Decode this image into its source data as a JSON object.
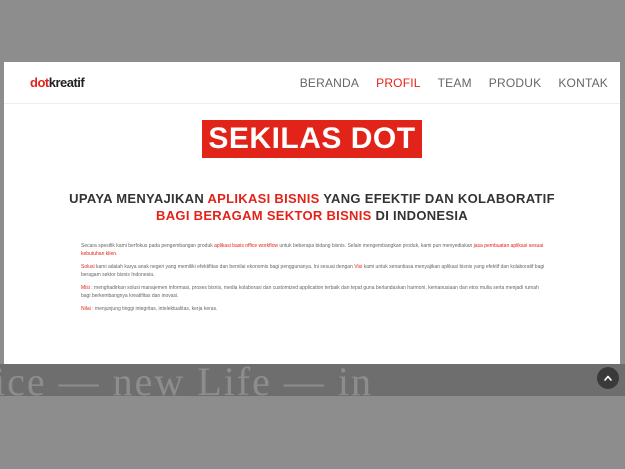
{
  "logo": {
    "part1": "dot",
    "part2": "kreatif"
  },
  "nav": [
    {
      "label": "BERANDA",
      "active": false
    },
    {
      "label": "PROFIL",
      "active": true
    },
    {
      "label": "TEAM",
      "active": false
    },
    {
      "label": "PRODUK",
      "active": false
    },
    {
      "label": "KONTAK",
      "active": false
    }
  ],
  "title": "SEKILAS DOT",
  "headline": {
    "l1a": "UPAYA MENYAJIKAN ",
    "l1b": "APLIKASI BISNIS",
    "l1c": " YANG EFEKTIF DAN KOLABORATIF",
    "l2a": "BAGI BERAGAM SEKTOR BISNIS",
    "l2b": " DI INDONESIA"
  },
  "paragraphs": {
    "p1a": "Secara spesifik kami berfokus pada pengembangan produk ",
    "p1b": "aplikasi basis office workflow",
    "p1c": " untuk beberapa bidang bisnis. Selain mengembangkan produk, kami pun menyediakan ",
    "p1d": "jasa pembuatan aplikasi sesuai kebutuhan klien",
    "p1e": ".",
    "p2a": "Solusi",
    "p2b": " kami adalah karya anak negeri yang memiliki efektifitas dan bernilai ekonomis bagi penggunanya. Ini sesuai dengan ",
    "p2c": "Visi",
    "p2d": " kami untuk senantiasa menyajikan aplikasi bisnis yang efektif dan kolaboratif bagi beragam sektor bisnis Indonesia.",
    "p3a": "Misi",
    "p3b": " : menghadirkan solusi manajemen informasi, proses bisnis, media kolaborasi dan customized application terbaik dan tepat guna berlandaskan harmoni, kemanusiaan dan etos mulia serta menjadi rumah bagi berkembangnya kreatifitas dan inovasi.",
    "p4a": "Nilai",
    "p4b": " : menjunjung tinggi integritas, intelektualitas, kerja keras."
  },
  "overlay_text": "ice — new Life — in",
  "scroll_icon": "chevron-up-icon",
  "colors": {
    "accent": "#e2231a",
    "backdrop": "#8d8d8d"
  }
}
